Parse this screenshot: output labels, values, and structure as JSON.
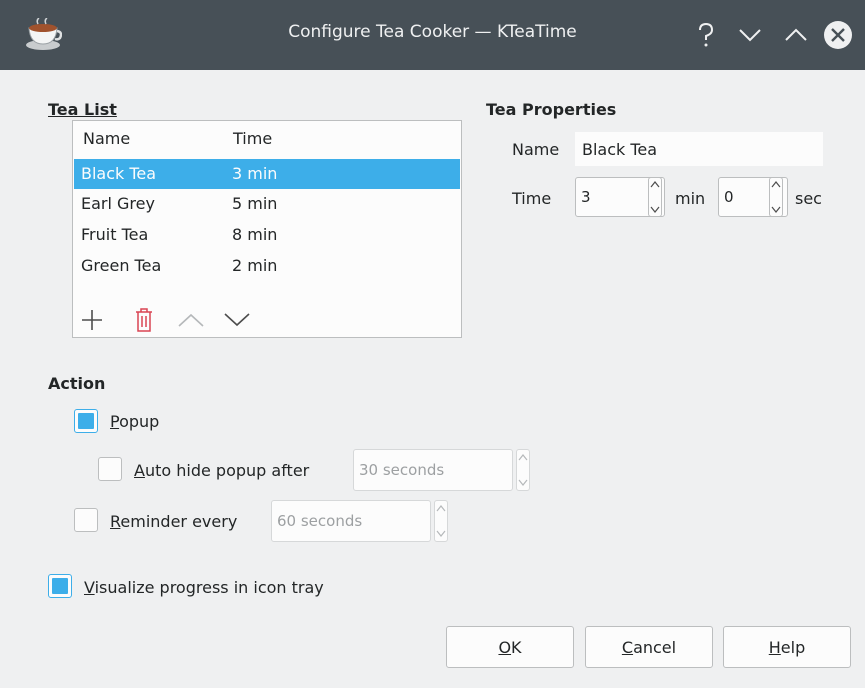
{
  "window": {
    "title": "Configure Tea Cooker — KTeaTime"
  },
  "tea_list": {
    "label": "Tea List",
    "columns": [
      "Name",
      "Time"
    ],
    "rows": [
      {
        "name": "Black Tea",
        "time": "3 min",
        "selected": true
      },
      {
        "name": "Earl Grey",
        "time": "5 min",
        "selected": false
      },
      {
        "name": "Fruit Tea",
        "time": "8 min",
        "selected": false
      },
      {
        "name": "Green Tea",
        "time": "2 min",
        "selected": false
      }
    ],
    "toolbar_icons": [
      "add-icon",
      "delete-icon",
      "move-up-icon",
      "move-down-icon"
    ]
  },
  "tea_properties": {
    "label": "Tea Properties",
    "name_label": "Name",
    "name_value": "Black Tea",
    "time_label": "Time",
    "minutes_value": "3",
    "minutes_unit": "min",
    "seconds_value": "0",
    "seconds_unit": "sec"
  },
  "action": {
    "label": "Action",
    "popup": {
      "first": "P",
      "rest": "opup",
      "checked": true
    },
    "auto_hide": {
      "first": "A",
      "rest": "uto hide popup after",
      "checked": false,
      "value": "30 seconds"
    },
    "reminder": {
      "first": "R",
      "rest": "eminder every",
      "checked": false,
      "value": "60 seconds"
    }
  },
  "visualize": {
    "first": "V",
    "rest": "isualize progress in icon tray",
    "checked": true
  },
  "buttons": {
    "ok": {
      "first": "O",
      "rest": "K"
    },
    "cancel": {
      "first": "C",
      "rest": "ancel"
    },
    "help": {
      "first": "H",
      "rest": "elp"
    }
  },
  "colors": {
    "selection": "#3daee9",
    "titlebar": "#475057",
    "delete_icon": "#da4453"
  }
}
